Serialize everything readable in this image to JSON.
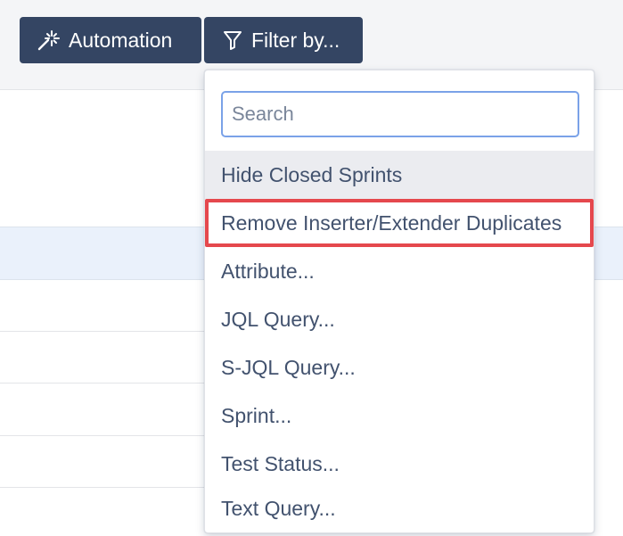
{
  "toolbar": {
    "automation_label": "Automation",
    "filter_label": "Filter by..."
  },
  "filter_menu": {
    "search_placeholder": "Search",
    "items": [
      {
        "label": "Hide Closed Sprints",
        "state": "hovered"
      },
      {
        "label": "Remove Inserter/Extender Duplicates",
        "state": "highlighted"
      },
      {
        "label": "Attribute..."
      },
      {
        "label": "JQL Query..."
      },
      {
        "label": "S-JQL Query..."
      },
      {
        "label": "Sprint..."
      },
      {
        "label": "Test Status..."
      },
      {
        "label": "Text Query..."
      }
    ]
  },
  "icons": {
    "automation": "magic-wand-icon",
    "filter": "funnel-icon"
  },
  "colors": {
    "button_bg": "#344563",
    "highlight_outline": "#e5484d",
    "hover_bg": "#ebecf0",
    "search_border": "#7aa2e8",
    "row_highlight": "#eaf1fb"
  }
}
